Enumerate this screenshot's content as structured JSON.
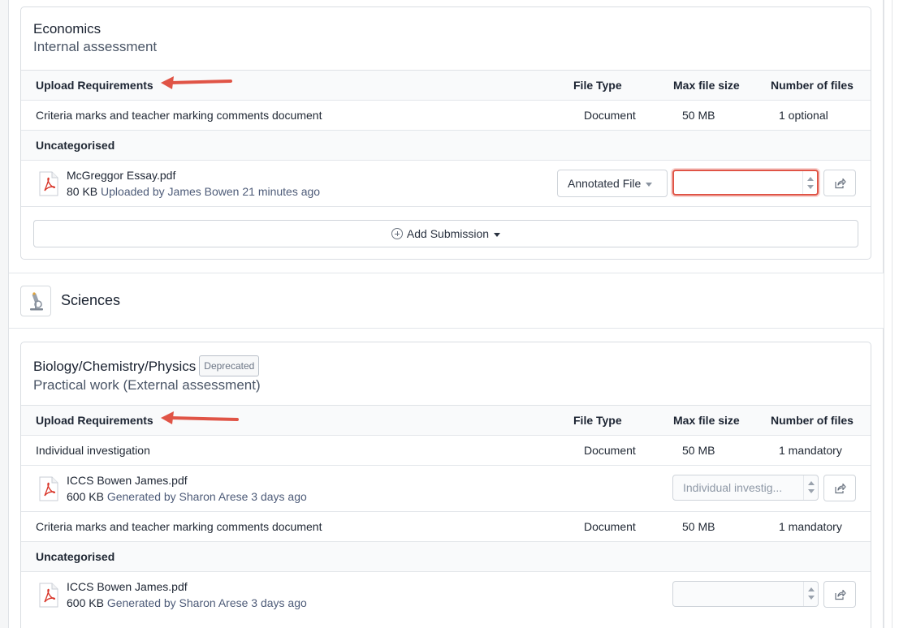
{
  "economics": {
    "title": "Economics",
    "subtitle": "Internal assessment",
    "columns": {
      "requirements": "Upload Requirements",
      "file_type": "File Type",
      "max_size": "Max file size",
      "num_files": "Number of files"
    },
    "requirement": {
      "name": "Criteria marks and teacher marking comments document",
      "file_type": "Document",
      "max_size": "50 MB",
      "num_files": "1 optional"
    },
    "group_label": "Uncategorised",
    "file": {
      "name": "McGreggor Essay.pdf",
      "size": "80 KB",
      "meta": "Uploaded by James Bowen 21 minutes ago",
      "category": "Annotated File",
      "stepper_value": ""
    },
    "add_submission": "Add Submission"
  },
  "sciences": {
    "section_title": "Sciences",
    "icon": "microscope-icon",
    "title": "Biology/Chemistry/Physics",
    "badge": "Deprecated",
    "subtitle": "Practical work (External assessment)",
    "columns": {
      "requirements": "Upload Requirements",
      "file_type": "File Type",
      "max_size": "Max file size",
      "num_files": "Number of files"
    },
    "requirements": [
      {
        "name": "Individual investigation",
        "file_type": "Document",
        "max_size": "50 MB",
        "num_files": "1 mandatory",
        "file": {
          "name": "ICCS Bowen James.pdf",
          "size": "600 KB",
          "meta": "Generated by Sharon Arese 3 days ago",
          "stepper_value": "Individual investig..."
        }
      },
      {
        "name": "Criteria marks and teacher marking comments document",
        "file_type": "Document",
        "max_size": "50 MB",
        "num_files": "1 mandatory"
      }
    ],
    "group_label": "Uncategorised",
    "group_file": {
      "name": "ICCS Bowen James.pdf",
      "size": "600 KB",
      "meta": "Generated by Sharon Arese 3 days ago",
      "stepper_value": ""
    }
  },
  "colors": {
    "annotation_red": "#e05446",
    "pdf_red": "#d9372b",
    "meta_blue": "#4d5b78"
  }
}
